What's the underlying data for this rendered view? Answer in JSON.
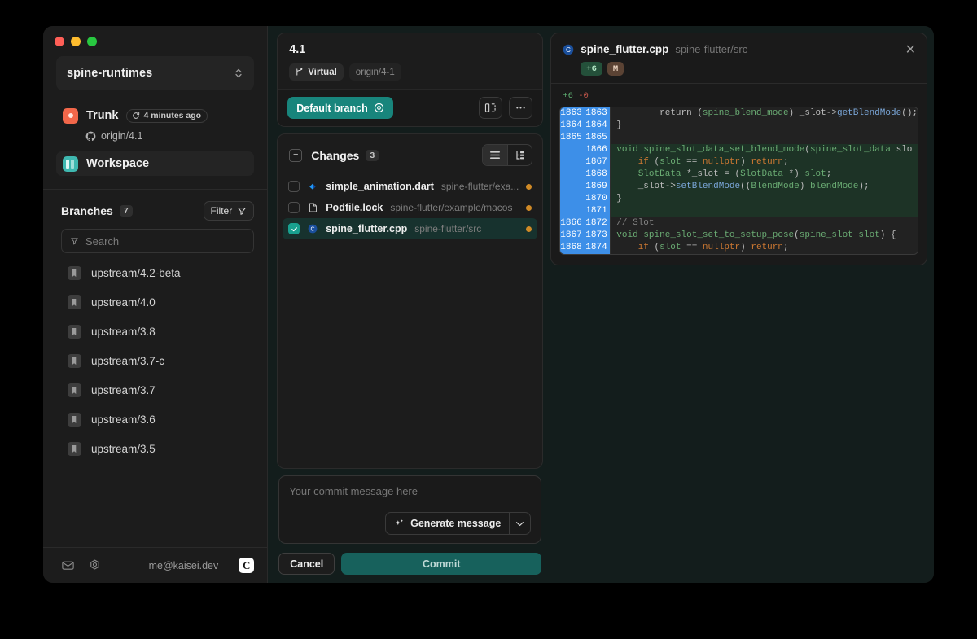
{
  "window": {
    "traffic_lights": [
      "close",
      "minimize",
      "maximize"
    ]
  },
  "sidebar": {
    "repo_selector": {
      "label": "spine-runtimes",
      "icon": "chevron-up-down-icon"
    },
    "nav": [
      {
        "label": "Trunk",
        "icon": "trunk-icon",
        "badge": "4 minutes ago",
        "badge_icon": "refresh-icon",
        "sub_label": "origin/4.1",
        "sub_icon": "github-icon"
      },
      {
        "label": "Workspace",
        "icon": "workspace-icon"
      }
    ],
    "branches": {
      "title": "Branches",
      "count": "7",
      "filter_label": "Filter",
      "filter_icon": "funnel-icon",
      "search_placeholder": "Search",
      "search_value": "",
      "search_icon": "funnel-icon",
      "items": [
        {
          "label": "upstream/4.2-beta",
          "icon": "branch-icon"
        },
        {
          "label": "upstream/4.0",
          "icon": "branch-icon"
        },
        {
          "label": "upstream/3.8",
          "icon": "branch-icon"
        },
        {
          "label": "upstream/3.7-c",
          "icon": "branch-icon"
        },
        {
          "label": "upstream/3.7",
          "icon": "branch-icon"
        },
        {
          "label": "upstream/3.6",
          "icon": "branch-icon"
        },
        {
          "label": "upstream/3.5",
          "icon": "branch-icon"
        }
      ]
    },
    "footer": {
      "mail_icon": "mail-icon",
      "settings_icon": "gear-icon",
      "email": "me@kaisei.dev",
      "avatar_letter": "C"
    }
  },
  "lane": {
    "title": "4.1",
    "tags": [
      {
        "label": "Virtual",
        "icon": "branch-icon"
      },
      {
        "label": "origin/4-1",
        "icon": ""
      }
    ],
    "default_branch_label": "Default branch",
    "default_branch_icon": "target-icon",
    "compare_icon": "side-by-side-icon",
    "more_icon": "ellipsis-icon"
  },
  "changes": {
    "collapse_icon": "minus-square-icon",
    "title": "Changes",
    "count": "3",
    "view_list_icon": "list-view-icon",
    "view_tree_icon": "tree-view-icon",
    "files": [
      {
        "name": "simple_animation.dart",
        "path": "spine-flutter/exa...",
        "checked": false,
        "selected": false,
        "type": "dart-file-icon",
        "status_color": "#d08a26"
      },
      {
        "name": "Podfile.lock",
        "path": "spine-flutter/example/macos",
        "checked": false,
        "selected": false,
        "type": "generic-file-icon",
        "status_color": "#d08a26"
      },
      {
        "name": "spine_flutter.cpp",
        "path": "spine-flutter/src",
        "checked": true,
        "selected": true,
        "type": "cpp-file-icon",
        "status_color": "#d08a26"
      }
    ]
  },
  "commit": {
    "message_placeholder": "Your commit message here",
    "message_value": "",
    "generate_label": "Generate message",
    "generate_icon": "sparkle-icon",
    "caret_icon": "chevron-down-icon",
    "cancel_label": "Cancel",
    "commit_label": "Commit"
  },
  "preview": {
    "file_icon": "cpp-file-icon",
    "file_name": "spine_flutter.cpp",
    "file_path": "spine-flutter/src",
    "close_icon": "close-icon",
    "badges": [
      {
        "label": "+6",
        "kind": "add"
      },
      {
        "label": "M",
        "kind": "mod"
      }
    ],
    "stats": {
      "added": "+6",
      "deleted": "-0"
    },
    "diff_lines": [
      {
        "old": "1863",
        "new": "1863",
        "kind": "ctx",
        "tokens": [
          {
            "t": "        return (",
            "c": "pl"
          },
          {
            "t": "spine_blend_mode",
            "c": "ty"
          },
          {
            "t": ") ",
            "c": "pl"
          },
          {
            "t": "_slot",
            "c": "pl"
          },
          {
            "t": "->",
            "c": "pl"
          },
          {
            "t": "getBlendMode",
            "c": "fn"
          },
          {
            "t": "();",
            "c": "pl"
          }
        ]
      },
      {
        "old": "1864",
        "new": "1864",
        "kind": "ctx",
        "tokens": [
          {
            "t": "}",
            "c": "pl"
          }
        ]
      },
      {
        "old": "1865",
        "new": "1865",
        "kind": "ctx",
        "tokens": [
          {
            "t": "",
            "c": "pl"
          }
        ]
      },
      {
        "old": "",
        "new": "1866",
        "kind": "add",
        "tokens": [
          {
            "t": "void ",
            "c": "ty"
          },
          {
            "t": "spine_slot_data_set_blend_mode",
            "c": "ty"
          },
          {
            "t": "(",
            "c": "pl"
          },
          {
            "t": "spine_slot_data",
            "c": "ty"
          },
          {
            "t": " slo",
            "c": "pl"
          }
        ]
      },
      {
        "old": "",
        "new": "1867",
        "kind": "add",
        "tokens": [
          {
            "t": "    ",
            "c": "pl"
          },
          {
            "t": "if",
            "c": "k"
          },
          {
            "t": " (",
            "c": "pl"
          },
          {
            "t": "slot",
            "c": "ty"
          },
          {
            "t": " == ",
            "c": "pl"
          },
          {
            "t": "nullptr",
            "c": "k"
          },
          {
            "t": ") ",
            "c": "pl"
          },
          {
            "t": "return",
            "c": "k"
          },
          {
            "t": ";",
            "c": "pl"
          }
        ]
      },
      {
        "old": "",
        "new": "1868",
        "kind": "add",
        "tokens": [
          {
            "t": "    ",
            "c": "pl"
          },
          {
            "t": "SlotData",
            "c": "ty"
          },
          {
            "t": " *_slot = (",
            "c": "pl"
          },
          {
            "t": "SlotData",
            "c": "ty"
          },
          {
            "t": " *) ",
            "c": "pl"
          },
          {
            "t": "slot",
            "c": "ty"
          },
          {
            "t": ";",
            "c": "pl"
          }
        ]
      },
      {
        "old": "",
        "new": "1869",
        "kind": "add",
        "tokens": [
          {
            "t": "    _slot->",
            "c": "pl"
          },
          {
            "t": "setBlendMode",
            "c": "fn"
          },
          {
            "t": "((",
            "c": "pl"
          },
          {
            "t": "BlendMode",
            "c": "ty"
          },
          {
            "t": ") ",
            "c": "pl"
          },
          {
            "t": "blendMode",
            "c": "ty"
          },
          {
            "t": ");",
            "c": "pl"
          }
        ]
      },
      {
        "old": "",
        "new": "1870",
        "kind": "add",
        "tokens": [
          {
            "t": "}",
            "c": "pl"
          }
        ]
      },
      {
        "old": "",
        "new": "1871",
        "kind": "add",
        "tokens": [
          {
            "t": "",
            "c": "pl"
          }
        ]
      },
      {
        "old": "1866",
        "new": "1872",
        "kind": "ctx",
        "tokens": [
          {
            "t": "// Slot",
            "c": "cm"
          }
        ]
      },
      {
        "old": "1867",
        "new": "1873",
        "kind": "ctx",
        "tokens": [
          {
            "t": "void ",
            "c": "ty"
          },
          {
            "t": "spine_slot_set_to_setup_pose",
            "c": "ty"
          },
          {
            "t": "(",
            "c": "pl"
          },
          {
            "t": "spine_slot",
            "c": "ty"
          },
          {
            "t": " ",
            "c": "pl"
          },
          {
            "t": "slot",
            "c": "ty"
          },
          {
            "t": ") {",
            "c": "pl"
          }
        ]
      },
      {
        "old": "1868",
        "new": "1874",
        "kind": "ctx",
        "tokens": [
          {
            "t": "    ",
            "c": "pl"
          },
          {
            "t": "if",
            "c": "k"
          },
          {
            "t": " (",
            "c": "pl"
          },
          {
            "t": "slot",
            "c": "ty"
          },
          {
            "t": " == ",
            "c": "pl"
          },
          {
            "t": "nullptr",
            "c": "k"
          },
          {
            "t": ") ",
            "c": "pl"
          },
          {
            "t": "return",
            "c": "k"
          },
          {
            "t": ";",
            "c": "pl"
          }
        ]
      }
    ]
  },
  "colors": {
    "accent_teal": "#18857c",
    "selection_teal": "#17322e",
    "gutter_blue": "#3d8fe8",
    "add_green_bg": "#1d3326",
    "status_orange": "#d08a26"
  }
}
